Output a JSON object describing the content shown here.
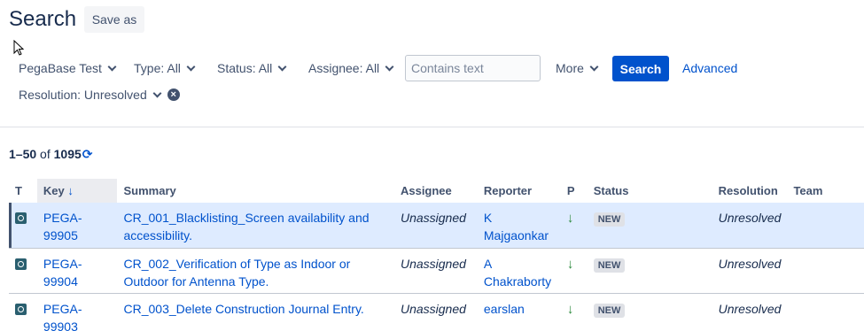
{
  "header": {
    "title": "Search",
    "save_as_label": "Save as"
  },
  "filters": {
    "project": "PegaBase Test",
    "type": "Type: All",
    "status": "Status: All",
    "assignee": "Assignee: All",
    "text_placeholder": "Contains text",
    "more": "More",
    "search_button": "Search",
    "advanced_link": "Advanced",
    "resolution": "Resolution: Unresolved"
  },
  "results": {
    "range": "1–50",
    "of": "of",
    "total": "1095"
  },
  "table": {
    "columns": [
      "T",
      "Key",
      "Summary",
      "Assignee",
      "Reporter",
      "P",
      "Status",
      "Resolution",
      "Team"
    ],
    "sort_indicator": "↓",
    "rows": [
      {
        "key": "PEGA-99905",
        "summary": "CR_001_Blacklisting_Screen availability and accessibility.",
        "assignee": "Unassigned",
        "reporter": "K Majgaonkar",
        "priority_icon": "down-arrow-icon",
        "status": "NEW",
        "resolution": "Unresolved",
        "team": ""
      },
      {
        "key": "PEGA-99904",
        "summary": "CR_002_Verification of Type as Indoor or Outdoor for Antenna Type.",
        "assignee": "Unassigned",
        "reporter": "A Chakraborty",
        "priority_icon": "down-arrow-icon",
        "status": "NEW",
        "resolution": "Unresolved",
        "team": ""
      },
      {
        "key": "PEGA-99903",
        "summary": "CR_003_Delete Construction Journal Entry.",
        "assignee": "Unassigned",
        "reporter": "earslan",
        "priority_icon": "down-arrow-icon",
        "status": "NEW",
        "resolution": "Unresolved",
        "team": ""
      }
    ]
  },
  "colors": {
    "primary": "#0052cc",
    "selected_row": "#deebff",
    "priority_low": "#2d8a3e"
  }
}
